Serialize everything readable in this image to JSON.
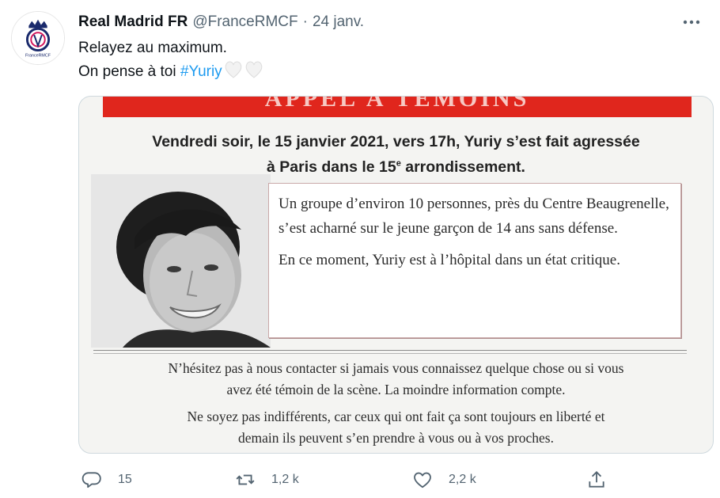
{
  "tweet": {
    "author_name": "Real Madrid FR",
    "handle": "@FranceRMCF",
    "separator": "·",
    "date": "24 janv.",
    "text_line1": "Relayez au maximum.",
    "text_line2_prefix": "On pense à toi ",
    "hashtag": "#Yuriy",
    "emoji": "white-heart x2",
    "avatar_caption": "FranceRMCF",
    "more_icon": "ellipsis-icon"
  },
  "media": {
    "banner_text": "APPEL À TÉMOINS",
    "headline_line1": "Vendredi soir, le 15 janvier 2021, vers 17h, Yuriy s’est fait agressée",
    "headline_line2_a": "à Paris dans le 15",
    "headline_line2_sup": "e",
    "headline_line2_b": " arrondissement.",
    "box_p1": "Un groupe d’environ 10 personnes, près du Centre Beaugrenelle, s’est acharné sur le jeune garçon de 14 ans sans défense.",
    "box_p2": "En ce moment, Yuriy est à l’hôpital dans un état critique.",
    "footer_p1_l1": "N’hésitez pas à nous contacter si jamais vous connaissez quelque chose ou si vous",
    "footer_p1_l2": "avez été témoin de la scène. La moindre information compte.",
    "footer_p2_l1": "Ne soyez pas indifférents, car ceux qui ont fait ça sont toujours en liberté et",
    "footer_p2_l2": "demain ils peuvent s’en prendre à vous ou à vos proches.",
    "accent_color": "#e0261d"
  },
  "actions": {
    "reply_count": "15",
    "retweet_count": "1,2 k",
    "like_count": "2,2 k",
    "icons": [
      "reply-icon",
      "retweet-icon",
      "like-icon",
      "share-icon"
    ]
  },
  "colors": {
    "link": "#1d9bf0",
    "secondary": "#536471",
    "border": "#cfd9de"
  }
}
